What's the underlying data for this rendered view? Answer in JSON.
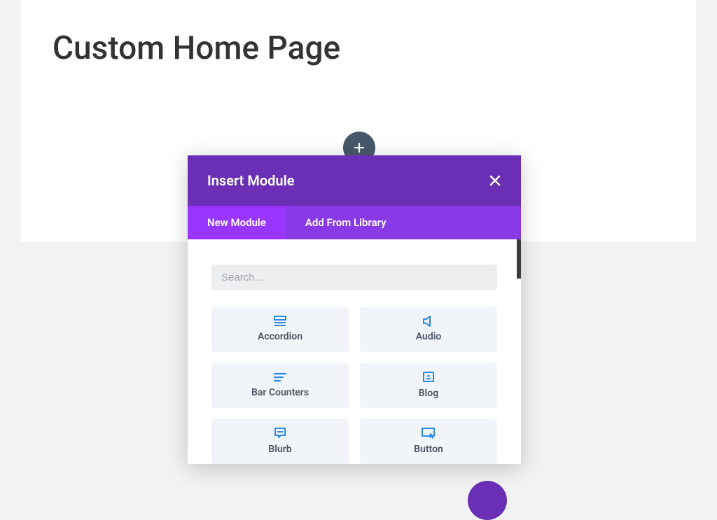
{
  "page_title": "Custom Home Page",
  "modal": {
    "title": "Insert Module",
    "tabs": {
      "new_module": "New Module",
      "add_from_library": "Add From Library"
    },
    "search_placeholder": "Search...",
    "modules": [
      {
        "label": "Accordion"
      },
      {
        "label": "Audio"
      },
      {
        "label": "Bar Counters"
      },
      {
        "label": "Blog"
      },
      {
        "label": "Blurb"
      },
      {
        "label": "Button"
      }
    ]
  }
}
